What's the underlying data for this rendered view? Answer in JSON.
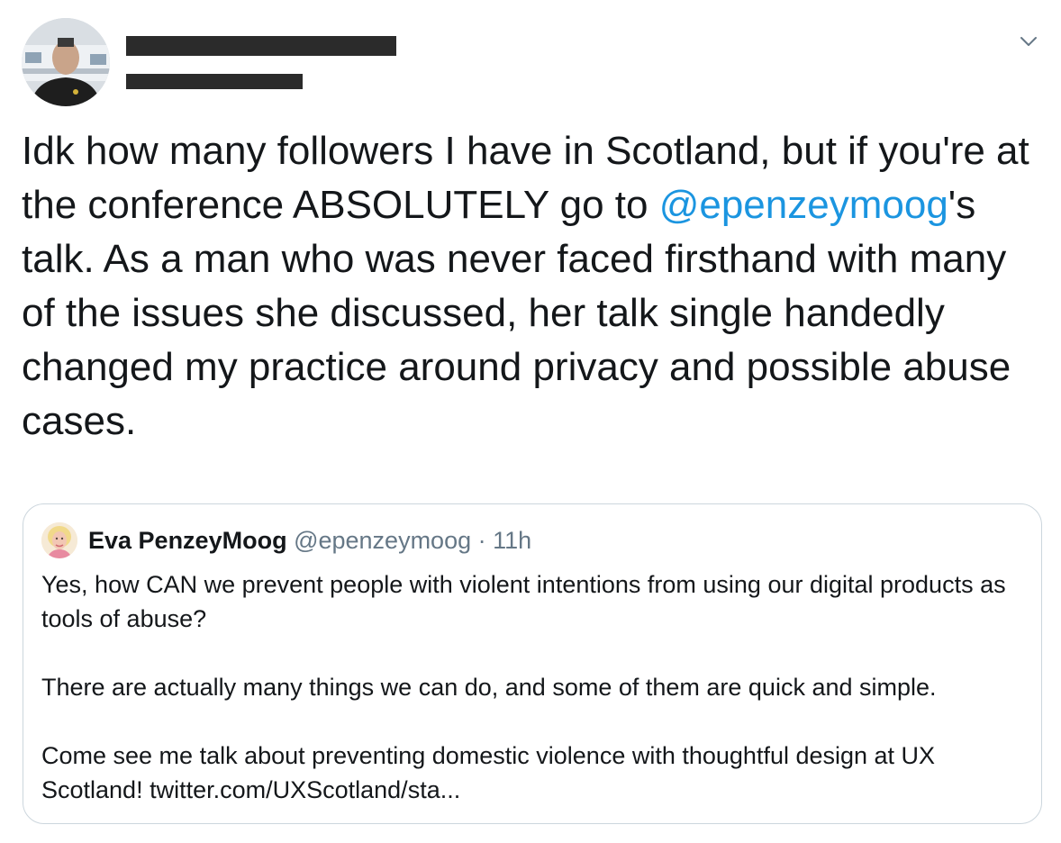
{
  "tweet": {
    "author_name_redacted": true,
    "author_handle_redacted": true,
    "text_before_mention": "Idk how many followers I have in Scotland, but if you're at the conference ABSOLUTELY go to ",
    "mention": "@epenzeymoog",
    "text_after_mention": "'s talk. As a man who was never faced firsthand with many of the issues she discussed, her talk single handedly changed my practice around privacy and possible abuse cases.",
    "menu_icon": "chevron-down-icon"
  },
  "quoted_tweet": {
    "author_name": "Eva PenzeyMoog",
    "author_handle": "@epenzeymoog",
    "separator": "·",
    "time": "11h",
    "paragraphs": [
      "Yes, how CAN we prevent people with violent intentions from using our digital products as tools of abuse?",
      "There are actually many things we can do, and some of them are quick and simple.",
      "Come see me talk about preventing domestic violence with thoughtful design at UX Scotland! twitter.com/UXScotland/sta..."
    ]
  },
  "colors": {
    "mention": "#1b95e0",
    "text": "#14171a",
    "secondary": "#657786",
    "border": "#ccd6dd"
  }
}
